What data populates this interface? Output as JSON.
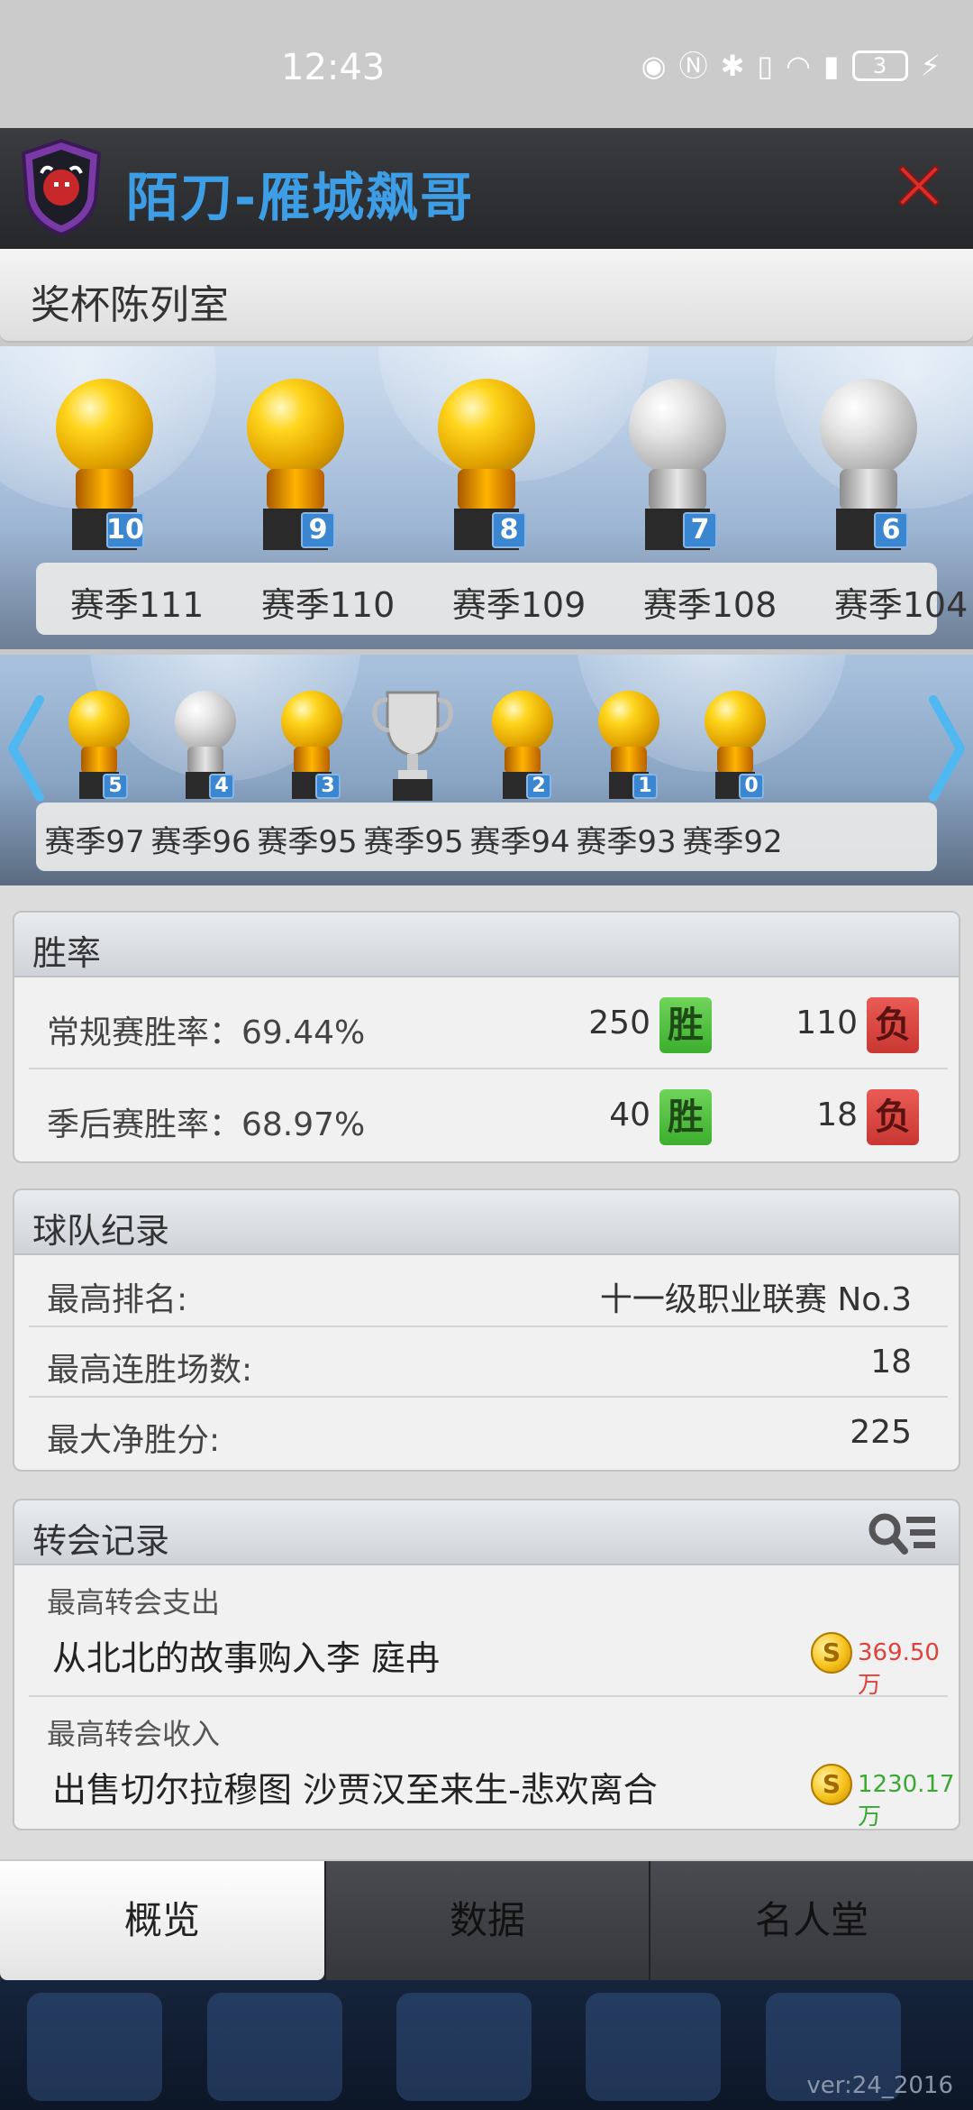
{
  "status_bar": {
    "time": "12:43",
    "battery": "3",
    "icons": [
      "eye-icon",
      "nfc-icon",
      "bluetooth-icon",
      "vibrate-icon",
      "wifi-icon",
      "signal-5g-icon",
      "charging-icon"
    ]
  },
  "header": {
    "title": "陌刀-雁城飙哥"
  },
  "trophy_room": {
    "title": "奖杯陈列室",
    "row1": [
      {
        "season": "赛季111",
        "badge": "10",
        "type": "gold"
      },
      {
        "season": "赛季110",
        "badge": "9",
        "type": "gold"
      },
      {
        "season": "赛季109",
        "badge": "8",
        "type": "gold"
      },
      {
        "season": "赛季108",
        "badge": "7",
        "type": "silver"
      },
      {
        "season": "赛季104",
        "badge": "6",
        "type": "silver"
      }
    ],
    "row2": [
      {
        "season": "赛季97",
        "badge": "5",
        "type": "gold"
      },
      {
        "season": "赛季96",
        "badge": "4",
        "type": "silver"
      },
      {
        "season": "赛季95",
        "badge": "3",
        "type": "gold"
      },
      {
        "season": "赛季95",
        "badge": "",
        "type": "cup"
      },
      {
        "season": "赛季94",
        "badge": "2",
        "type": "gold"
      },
      {
        "season": "赛季93",
        "badge": "1",
        "type": "gold"
      },
      {
        "season": "赛季92",
        "badge": "0",
        "type": "gold"
      }
    ]
  },
  "win_rate": {
    "title": "胜率",
    "regular": {
      "label": "常规赛胜率：69.44%",
      "wins": "250",
      "win_tag": "胜",
      "losses": "110",
      "loss_tag": "负"
    },
    "playoff": {
      "label": "季后赛胜率：68.97%",
      "wins": "40",
      "win_tag": "胜",
      "losses": "18",
      "loss_tag": "负"
    }
  },
  "team_record": {
    "title": "球队纪录",
    "rows": [
      {
        "label": "最高排名:",
        "value": "十一级职业联赛 No.3"
      },
      {
        "label": "最高连胜场数:",
        "value": "18"
      },
      {
        "label": "最大净胜分:",
        "value": "225"
      }
    ]
  },
  "transfer_record": {
    "title": "转会记录",
    "expense": {
      "label": "最高转会支出",
      "desc": "从北北的故事购入李 庭冉",
      "amount": "369.50万",
      "color": "#e0413b"
    },
    "income": {
      "label": "最高转会收入",
      "desc": "出售切尔拉穆图 沙贾汉至来生-悲欢离合",
      "amount": "1230.17万",
      "color": "#3aa832"
    }
  },
  "tabs": [
    "概览",
    "数据",
    "名人堂"
  ],
  "version": "ver:24_2016",
  "colors": {
    "title_blue": "#3d9ee6",
    "close_red": "#d9302b",
    "badge_blue": "#3b86d1"
  }
}
